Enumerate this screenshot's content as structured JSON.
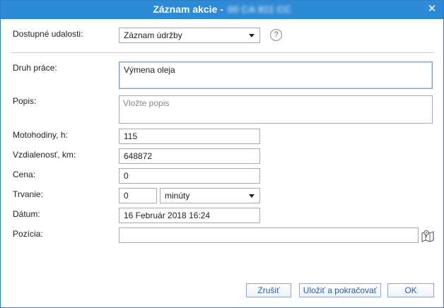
{
  "dialog": {
    "title": "Záznam akcie -",
    "plate": "00 CA 811 CC",
    "close_glyph": "✕"
  },
  "form": {
    "available_events": {
      "label": "Dostupné udalosti:",
      "value": "Záznam údržby"
    },
    "help_glyph": "?",
    "work_type": {
      "label": "Druh práce:",
      "value": "Výmena oleja"
    },
    "description": {
      "label": "Popis:",
      "placeholder": "Vložte popis",
      "value": ""
    },
    "engine_hours": {
      "label": "Motohodiny, h:",
      "value": "115"
    },
    "distance": {
      "label": "Vzdialenosť, km:",
      "value": "648872"
    },
    "price": {
      "label": "Cena:",
      "value": "0"
    },
    "duration": {
      "label": "Trvanie:",
      "value": "0",
      "unit": "minúty"
    },
    "date": {
      "label": "Dátum:",
      "value": "16 Február 2018 16:24"
    },
    "position": {
      "label": "Pozícia:",
      "value": ""
    }
  },
  "buttons": {
    "cancel": "Zrušiť",
    "save_continue": "Uložiť a pokračovať",
    "ok": "OK"
  },
  "icons": {
    "help": "help-circle-icon",
    "map": "map-marker-icon",
    "close": "close-icon"
  }
}
